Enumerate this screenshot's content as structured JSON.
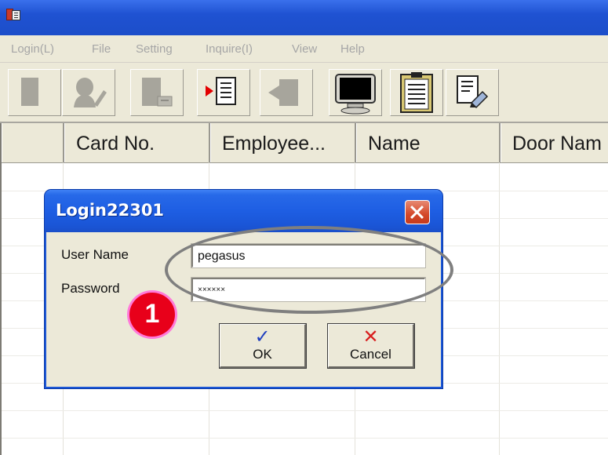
{
  "menu": {
    "items": [
      {
        "label": "Login(L)"
      },
      {
        "label": "File"
      },
      {
        "label": "Setting"
      },
      {
        "label": "Inquire(I)"
      },
      {
        "label": "View"
      },
      {
        "label": "Help"
      }
    ]
  },
  "toolbar": {
    "buttons": [
      {
        "icon": "blank-disabled-icon",
        "enabled": false
      },
      {
        "icon": "user-edit-icon",
        "enabled": false
      },
      {
        "icon": "card-print-icon",
        "enabled": false
      },
      {
        "icon": "export-document-icon",
        "enabled": true
      },
      {
        "icon": "door-disabled-icon",
        "enabled": false
      },
      {
        "icon": "monitor-icon",
        "enabled": true
      },
      {
        "icon": "clipboard-icon",
        "enabled": true
      },
      {
        "icon": "document-edit-icon",
        "enabled": true
      }
    ]
  },
  "grid": {
    "columns": [
      "",
      "Card No.",
      "Employee...",
      "Name",
      "Door Nam"
    ]
  },
  "dialog": {
    "title": "Login22301",
    "user_label": "User Name",
    "password_label": "Password",
    "username_value": "pegasus",
    "password_value": "××××××",
    "ok_label": "OK",
    "cancel_label": "Cancel"
  },
  "annotation": {
    "step": "1"
  },
  "colors": {
    "title_blue": "#2a5fdc",
    "window_face": "#ece9d8",
    "close_red": "#d4482a",
    "badge_red": "#e8001a",
    "ok_check": "#1f3fbf",
    "cancel_x": "#d81e1e"
  }
}
